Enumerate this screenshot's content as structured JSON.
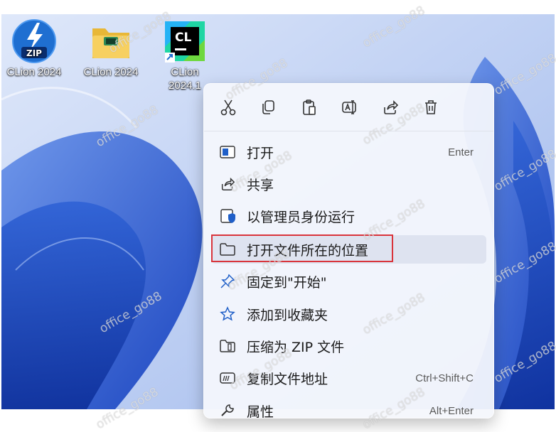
{
  "desktop": {
    "icons": [
      {
        "label": "CLion 2024",
        "icon": "zip-archive-icon"
      },
      {
        "label": "CLion 2024",
        "icon": "folder-icon"
      },
      {
        "label_line1": "CLion",
        "label_line2": "2024.1",
        "icon": "clion-app-icon"
      }
    ]
  },
  "context_menu": {
    "quick_actions": [
      {
        "icon": "cut-icon"
      },
      {
        "icon": "copy-icon"
      },
      {
        "icon": "paste-icon"
      },
      {
        "icon": "rename-icon"
      },
      {
        "icon": "share-icon"
      },
      {
        "icon": "delete-icon"
      }
    ],
    "items": [
      {
        "label": "打开",
        "shortcut": "Enter",
        "icon": "open-icon"
      },
      {
        "label": "共享",
        "icon": "share-icon"
      },
      {
        "label": "以管理员身份运行",
        "icon": "shield-icon"
      },
      {
        "label": "打开文件所在的位置",
        "icon": "folder-icon",
        "highlighted": true
      },
      {
        "label": "固定到\"开始\"",
        "icon": "pin-icon"
      },
      {
        "label": "添加到收藏夹",
        "icon": "star-icon"
      },
      {
        "label": "压缩为 ZIP 文件",
        "icon": "zip-icon"
      },
      {
        "label": "复制文件地址",
        "shortcut": "Ctrl+Shift+C",
        "icon": "copy-path-icon"
      },
      {
        "label": "属性",
        "shortcut": "Alt+Enter",
        "icon": "wrench-icon"
      }
    ]
  },
  "watermark": {
    "text": "office_go88"
  },
  "colors": {
    "highlight_border": "#d9343b",
    "wallpaper_accent": "#1d4cc4"
  }
}
